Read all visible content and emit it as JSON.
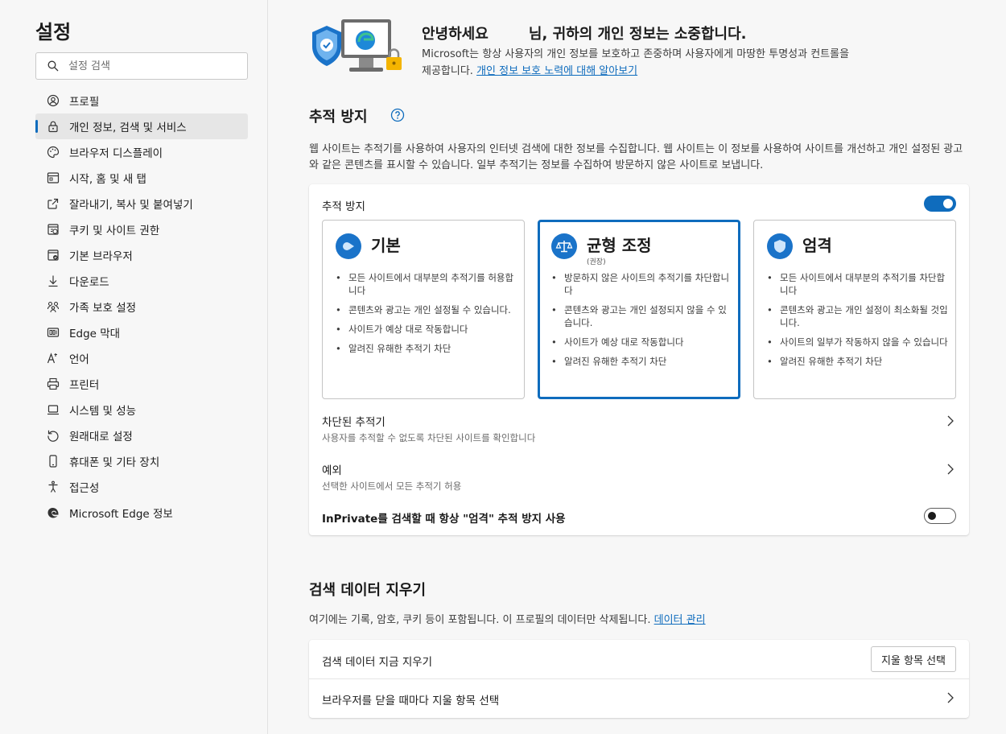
{
  "sidebar": {
    "title": "설정",
    "search_placeholder": "설정 검색",
    "items": [
      {
        "label": "프로필",
        "icon": "profile-icon"
      },
      {
        "label": "개인 정보, 검색 및 서비스",
        "icon": "lock-icon",
        "active": true
      },
      {
        "label": "브라우저 디스플레이",
        "icon": "palette-icon"
      },
      {
        "label": "시작, 홈 및 새 탭",
        "icon": "home-tab-icon"
      },
      {
        "label": "잘라내기, 복사 및 붙여넣기",
        "icon": "share-icon"
      },
      {
        "label": "쿠키 및 사이트 권한",
        "icon": "cookie-icon"
      },
      {
        "label": "기본 브라우저",
        "icon": "default-browser-icon"
      },
      {
        "label": "다운로드",
        "icon": "download-icon"
      },
      {
        "label": "가족 보호 설정",
        "icon": "family-icon"
      },
      {
        "label": "Edge 막대",
        "icon": "edge-bar-icon"
      },
      {
        "label": "언어",
        "icon": "language-icon"
      },
      {
        "label": "프린터",
        "icon": "printer-icon"
      },
      {
        "label": "시스템 및 성능",
        "icon": "laptop-icon"
      },
      {
        "label": "원래대로 설정",
        "icon": "reset-icon"
      },
      {
        "label": "휴대폰 및 기타 장치",
        "icon": "phone-icon"
      },
      {
        "label": "접근성",
        "icon": "accessibility-icon"
      },
      {
        "label": "Microsoft Edge 정보",
        "icon": "edge-logo-icon"
      }
    ]
  },
  "hero": {
    "title": "안녕하세요        님, 귀하의 개인 정보는 소중합니다.",
    "desc": "Microsoft는 항상 사용자의 개인 정보를 보호하고 존중하며 사용자에게 마땅한 투명성과 컨트롤을 제공합니다.",
    "link": "개인 정보 보호 노력에 대해 알아보기"
  },
  "tracking": {
    "title": "추적 방지",
    "desc": "웹 사이트는 추적기를 사용하여 사용자의 인터넷 검색에 대한 정보를 수집합니다. 웹 사이트는 이 정보를 사용하여 사이트를 개선하고 개인 설정된 광고와 같은 콘텐츠를 표시할 수 있습니다. 일부 추적기는 정보를 수집하여 방문하지 않은 사이트로 보냅니다.",
    "card_label": "추적 방지",
    "toggle_on": true,
    "options": [
      {
        "title": "기본",
        "sub": "",
        "selected": false,
        "bullets": [
          "모든 사이트에서 대부분의 추적기를 허용합니다",
          "콘텐츠와 광고는 개인 설정될 수 있습니다.",
          "사이트가 예상 대로 작동합니다",
          "알려진 유해한 추적기 차단"
        ]
      },
      {
        "title": "균형 조정",
        "sub": "(권장)",
        "selected": true,
        "bullets": [
          "방문하지 않은 사이트의 추적기를 차단합니다",
          "콘텐츠와 광고는 개인 설정되지 않을 수 있습니다.",
          "사이트가 예상 대로 작동합니다",
          "알려진 유해한 추적기 차단"
        ]
      },
      {
        "title": "엄격",
        "sub": "",
        "selected": false,
        "bullets": [
          "모든 사이트에서 대부분의 추적기를 차단합니다",
          "콘텐츠와 광고는 개인 설정이 최소화될 것입니다.",
          "사이트의 일부가 작동하지 않을 수 있습니다",
          "알려진 유해한 추적기 차단"
        ]
      }
    ],
    "blocked_title": "차단된 추적기",
    "blocked_sub": "사용자를 추적할 수 없도록 차단된 사이트를 확인합니다",
    "exceptions_title": "예외",
    "exceptions_sub": "선택한 사이트에서 모든 추적기 허용",
    "inprivate_label": "InPrivate를 검색할 때 항상 \"엄격\" 추적 방지 사용",
    "inprivate_on": false
  },
  "clear_data": {
    "title": "검색 데이터 지우기",
    "desc": "여기에는 기록, 암호, 쿠키 등이 포함됩니다. 이 프로필의 데이터만 삭제됩니다.",
    "link": "데이터 관리",
    "now_label": "검색 데이터 지금 지우기",
    "choose_button": "지울 항목 선택",
    "on_close_label": "브라우저를 닫을 때마다 지울 항목 선택"
  },
  "colors": {
    "accent": "#0f6cbd",
    "background": "#f7f7f7",
    "card": "#ffffff"
  }
}
